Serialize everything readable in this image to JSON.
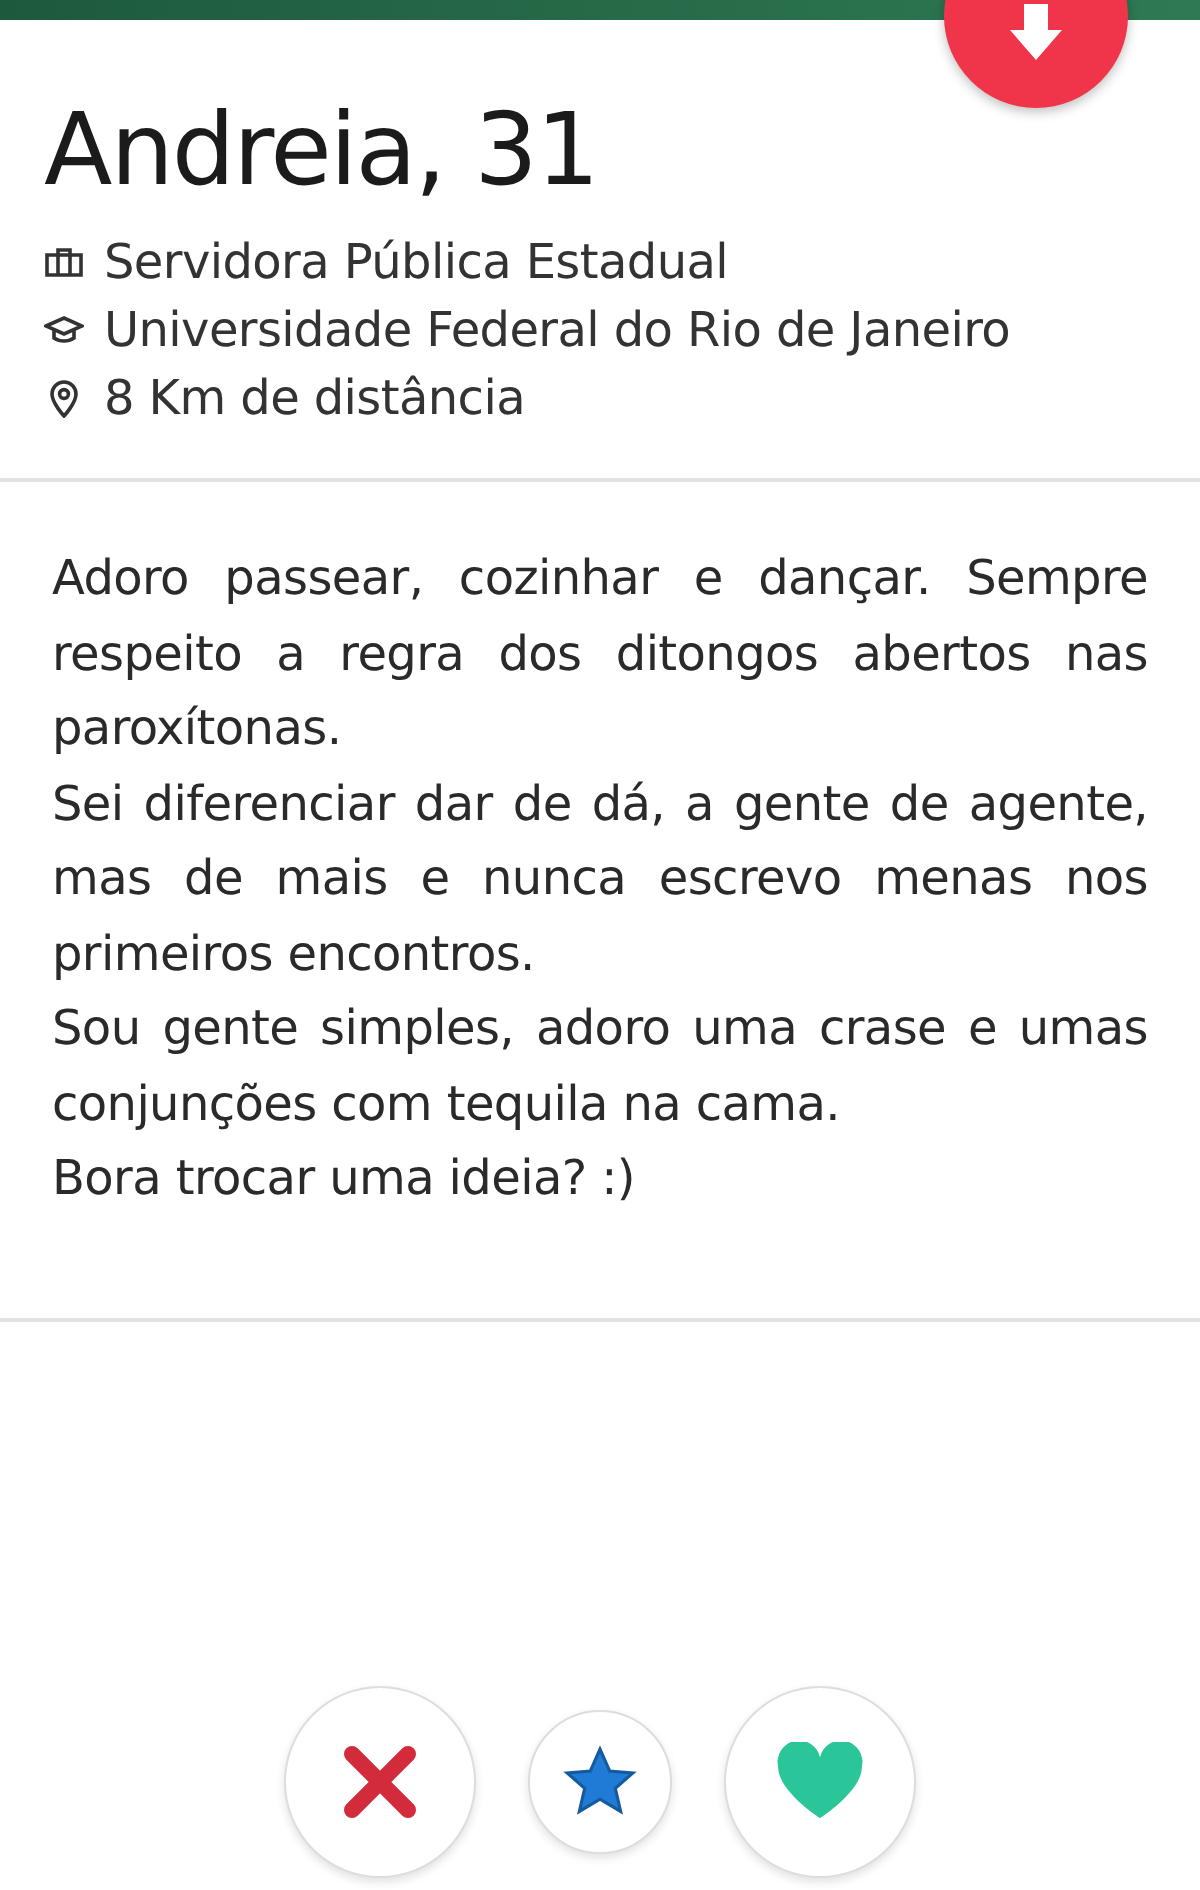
{
  "profile": {
    "name": "Andreia, 31",
    "details": [
      {
        "kind": "job",
        "text": "Servidora Pública Estadual"
      },
      {
        "kind": "school",
        "text": "Universidade Federal do Rio de Janeiro"
      },
      {
        "kind": "distance",
        "text": "8 Km de distância"
      }
    ]
  },
  "bio": [
    "Adoro passear, cozinhar e dançar. Sempre respeito a regra dos ditongos abertos nas paroxítonas.",
    "Sei diferenciar dar de dá, a gente de agente, mas de mais e nunca escrevo menas nos primeiros encontros.",
    "Sou gente simples, adoro uma crase e umas conjunções com tequila na cama.",
    "Bora trocar uma ideia? :)"
  ],
  "actions": [
    {
      "kind": "nope"
    },
    {
      "kind": "superlike"
    },
    {
      "kind": "like"
    }
  ]
}
